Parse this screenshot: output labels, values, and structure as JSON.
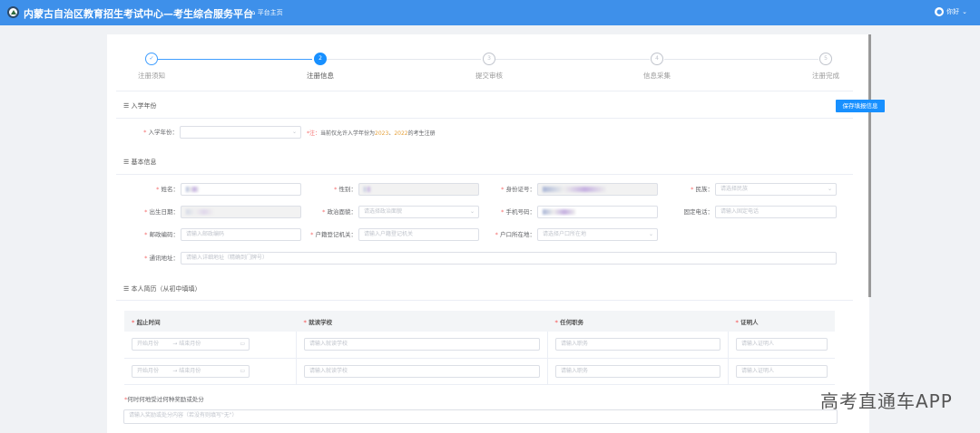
{
  "header": {
    "title": "内蒙古自治区教育招生考试中心—考生综合服务平台",
    "home": "平台主页",
    "user": "你好"
  },
  "steps": [
    {
      "n": "✓",
      "label": "注册须知"
    },
    {
      "n": "2",
      "label": "注册信息"
    },
    {
      "n": "3",
      "label": "提交审核"
    },
    {
      "n": "4",
      "label": "信息采集"
    },
    {
      "n": "5",
      "label": "注册完成"
    }
  ],
  "save_button": "保存填报信息",
  "sections": {
    "year": "入学年份",
    "basic": "基本信息",
    "resume": "本人简历（从初中填填）"
  },
  "year_field": {
    "label": "入学年份：",
    "note_prefix": "*注：",
    "note_text": "当前仅允许入学年份为",
    "y1": "2023",
    "sep": "、",
    "y2": "2022",
    "note_suffix": "的考生注册"
  },
  "fields": {
    "name": "姓名：",
    "gender": "性别：",
    "idcard": "身份证号：",
    "nation": "民族：",
    "nation_ph": "请选择民族",
    "birth": "出生日期：",
    "political": "政治面貌：",
    "political_ph": "请选择政治面貌",
    "phone": "手机号码：",
    "tel": "固定电话：",
    "tel_ph": "请输入固定电话",
    "postcode": "邮政编码：",
    "postcode_ph": "请输入邮政编码",
    "hukou_office": "户籍登记机关：",
    "hukou_office_ph": "请输入户籍登记机关",
    "hukou": "户口所在地：",
    "hukou_ph": "请选择户口所在地",
    "address": "通讯地址：",
    "address_ph": "请输入详细地址（精确到门牌号）"
  },
  "resume_table": {
    "headers": [
      "起止时间",
      "就读学校",
      "任何职务",
      "证明人"
    ],
    "start_ph": "开始月份",
    "end_ph": "结束月份",
    "school_ph": "请输入就读学校",
    "duty_ph": "请输入职务",
    "witness_ph": "请输入证明人",
    "arrow": "→"
  },
  "reward": {
    "label": "何时何地受过何种奖励或处分",
    "placeholder": "请输入奖励或处分内容（若没有则填写\"无\"）"
  },
  "watermark": "高考直通车APP"
}
